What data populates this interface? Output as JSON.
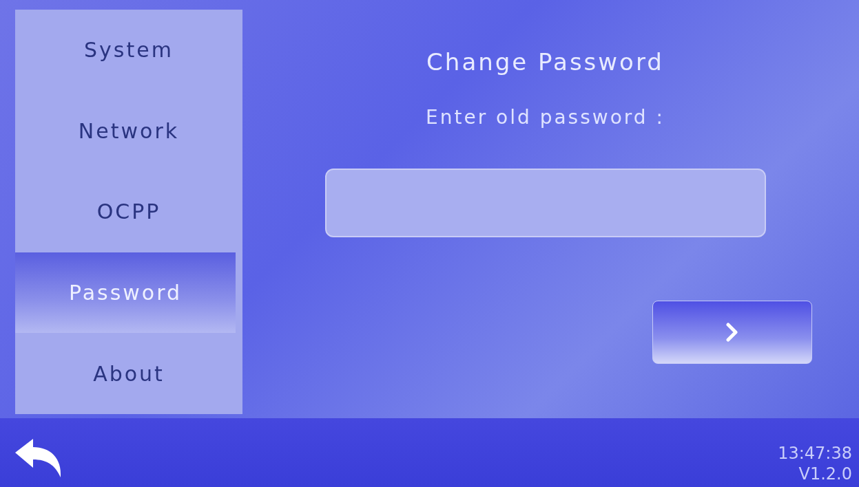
{
  "sidebar": {
    "items": [
      {
        "label": "System",
        "selected": false
      },
      {
        "label": "Network",
        "selected": false
      },
      {
        "label": "OCPP",
        "selected": false
      },
      {
        "label": "Password",
        "selected": true
      },
      {
        "label": "About",
        "selected": false
      }
    ]
  },
  "main": {
    "title": "Change Password",
    "prompt": "Enter old password :"
  },
  "status_bar": {
    "time": "13:47:38",
    "version": "V1.2.0"
  }
}
